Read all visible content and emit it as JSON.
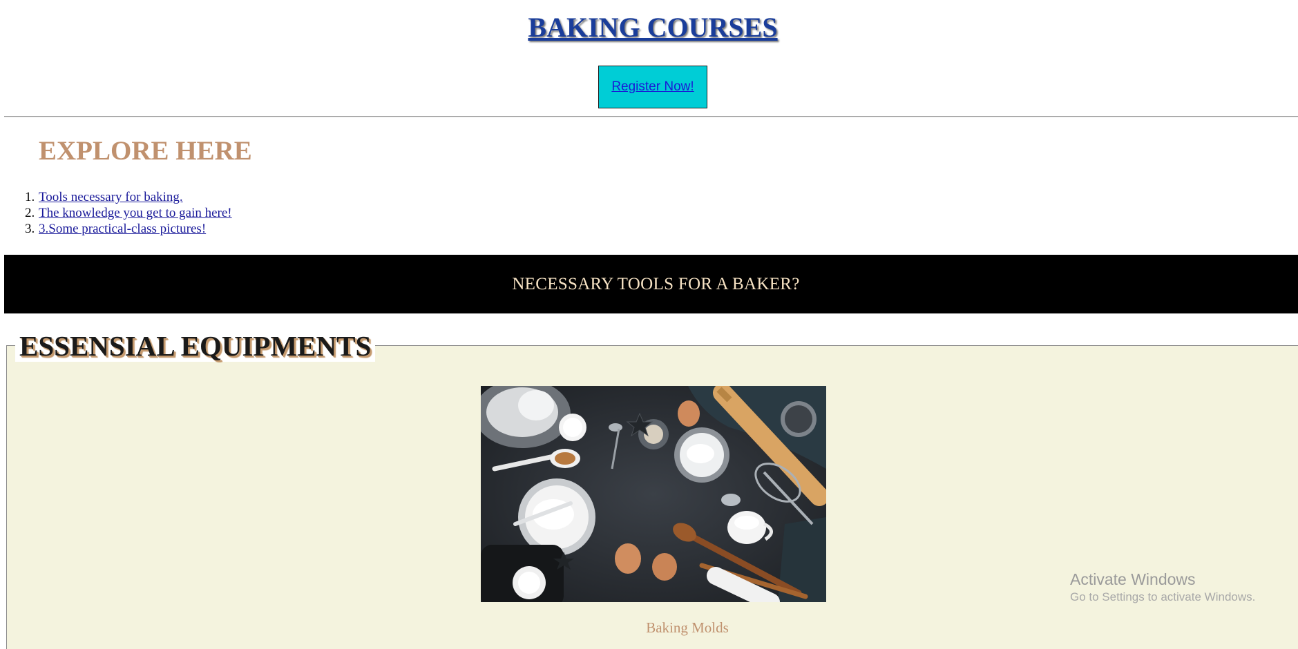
{
  "header": {
    "title": "BAKING COURSES",
    "register_label": "Register Now!"
  },
  "explore": {
    "heading": "EXPLORE HERE",
    "items": [
      {
        "number": "1.",
        "label": "Tools necessary for baking."
      },
      {
        "number": "2.",
        "label": "The knowledge you get to gain here!"
      },
      {
        "number": "3.",
        "label": "3.Some practical-class pictures!"
      }
    ]
  },
  "banner": {
    "text": "NECESSARY TOOLS FOR A BAKER?"
  },
  "equipment": {
    "legend": "ESSENSIAL EQUIPMENTS",
    "photo_caption": "Baking Molds"
  },
  "watermark": {
    "title": "Activate Windows",
    "subtitle": "Go to Settings to activate Windows."
  },
  "colors": {
    "title_link": "#1a3d9a",
    "register_bg": "#00cdd6",
    "explore_heading": "#c0916e",
    "banner_bg": "#000000",
    "banner_text": "#f7e3c4",
    "fieldset_bg": "#f4f3de"
  }
}
